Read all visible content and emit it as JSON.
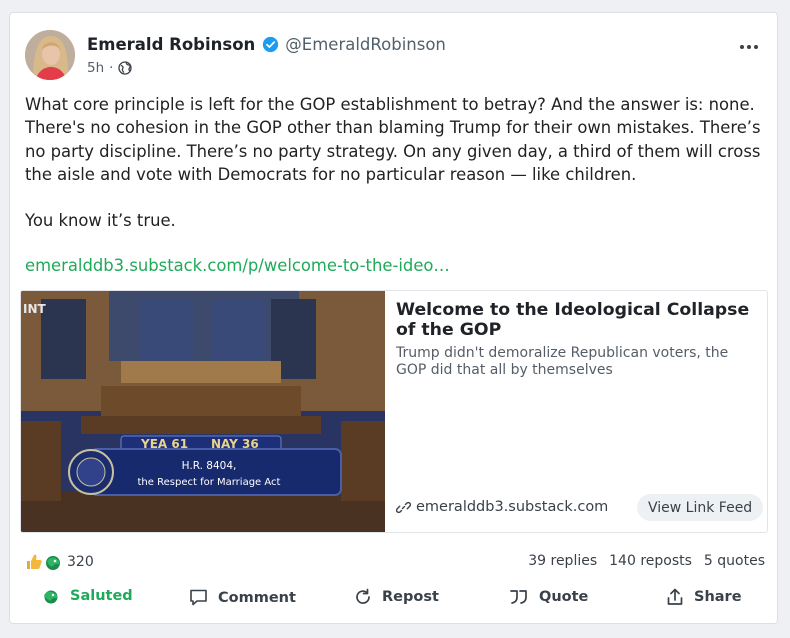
{
  "author": {
    "name": "Emerald Robinson",
    "handle": "@EmeraldRobinson",
    "time": "5h",
    "visibility_icon": "globe-icon"
  },
  "post": {
    "paragraph1": "What core principle is left for the GOP establishment to betray? And the answer is: none. There's no cohesion in the GOP other than blaming Trump for their own mistakes. There’s no party discipline. There’s no party strategy. On any given day, a third of them will cross the aisle and vote with Democrats for no particular reason — like children.",
    "paragraph2": "You know it’s true.",
    "link": "emeralddb3.substack.com/p/welcome-to-the-ideo…"
  },
  "preview": {
    "title": "Welcome to the Ideological Collapse of the GOP",
    "description": "Trump didn't demoralize Republican voters, the GOP did that all by themselves",
    "domain": "emeralddb3.substack.com",
    "feed_button": "View Link Feed",
    "image": {
      "corner_text": "INT",
      "yea": "YEA 61",
      "nay": "NAY 36",
      "bill": "H.R. 8404,",
      "bill_name": "the Respect for Marriage Act"
    }
  },
  "stats": {
    "reactions": "320",
    "replies": "39 replies",
    "reposts": "140 reposts",
    "quotes": "5 quotes"
  },
  "actions": {
    "saluted": "Saluted",
    "comment": "Comment",
    "repost": "Repost",
    "quote": "Quote",
    "share": "Share"
  },
  "colors": {
    "accent_green": "#1faa59",
    "verified_blue": "#1d9bf0",
    "text_secondary": "#53606b"
  }
}
